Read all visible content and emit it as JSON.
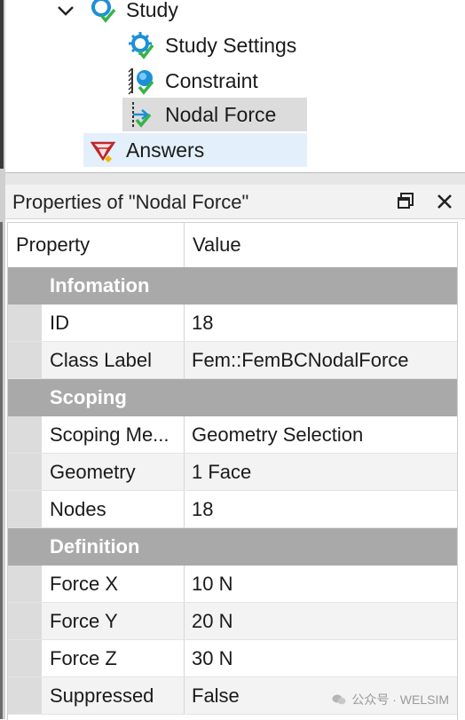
{
  "tree": {
    "study_label": "Study",
    "children": [
      {
        "label": "Study Settings",
        "icon": "gear-check-icon"
      },
      {
        "label": "Constraint",
        "icon": "constraint-icon"
      },
      {
        "label": "Nodal Force",
        "icon": "nodal-force-icon"
      },
      {
        "label": "Answers",
        "icon": "answers-gem-icon"
      }
    ]
  },
  "panel": {
    "title": "Properties of \"Nodal Force\"",
    "restore_icon": "restore-window-icon",
    "close_icon": "close-icon"
  },
  "grid": {
    "col_property": "Property",
    "col_value": "Value",
    "categories": [
      {
        "name": "Infomation",
        "rows": [
          {
            "key": "ID",
            "value": "18"
          },
          {
            "key": "Class Label",
            "value": "Fem::FemBCNodalForce"
          }
        ]
      },
      {
        "name": "Scoping",
        "rows": [
          {
            "key": "Scoping Me...",
            "value": "Geometry Selection"
          },
          {
            "key": "Geometry",
            "value": "1 Face"
          },
          {
            "key": "Nodes",
            "value": "18"
          }
        ]
      },
      {
        "name": "Definition",
        "rows": [
          {
            "key": "Force X",
            "value": "10 N"
          },
          {
            "key": "Force Y",
            "value": "20 N"
          },
          {
            "key": "Force Z",
            "value": "30 N"
          },
          {
            "key": "Suppressed",
            "value": "False"
          }
        ]
      }
    ]
  },
  "watermark": "公众号 · WELSIM",
  "colors": {
    "category_bg": "#a9a9a9",
    "selected_bg": "#dcdcdc",
    "hover_bg": "#e3f0fb",
    "accent_blue": "#1d8fd8"
  }
}
